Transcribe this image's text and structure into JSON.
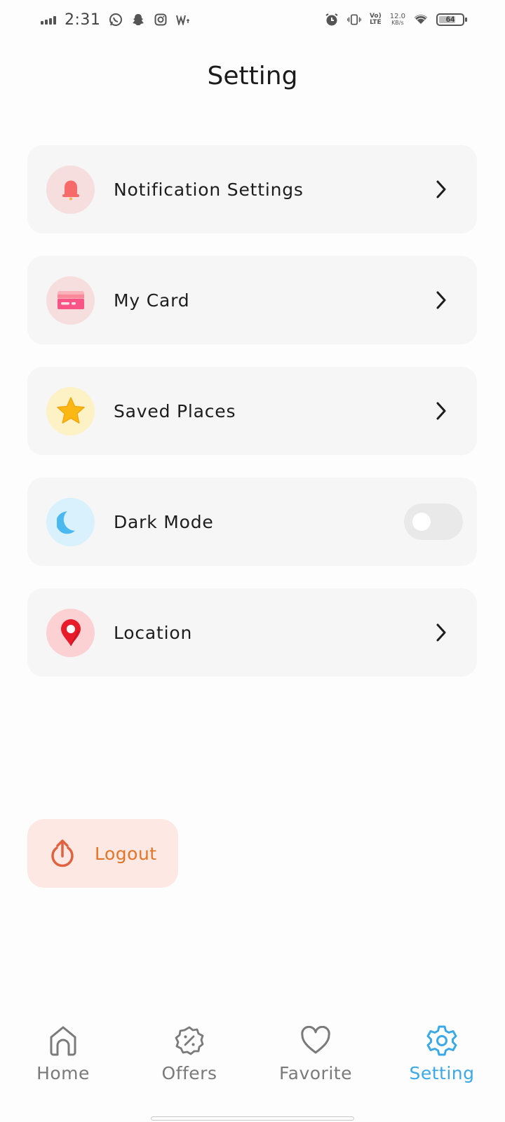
{
  "status_bar": {
    "time": "2:31",
    "net_speed_value": "12.0",
    "net_speed_unit": "KB/s",
    "volte_top": "Vo)",
    "volte_bottom": "LTE",
    "battery_level": "64",
    "notification_icons": [
      "whatsapp-icon",
      "snapchat-icon",
      "instagram-icon",
      "w-app-icon"
    ]
  },
  "header": {
    "title": "Setting"
  },
  "settings": {
    "items": [
      {
        "label": "Notification Settings",
        "icon": "bell-icon",
        "icon_bg": "#f6dede",
        "control": "chevron"
      },
      {
        "label": "My Card",
        "icon": "card-icon",
        "icon_bg": "#f6dede",
        "control": "chevron"
      },
      {
        "label": "Saved Places",
        "icon": "star-icon",
        "icon_bg": "#fdf1c6",
        "control": "chevron"
      },
      {
        "label": "Dark Mode",
        "icon": "moon-icon",
        "icon_bg": "#d8f1fc",
        "control": "toggle",
        "toggle_on": false
      },
      {
        "label": "Location",
        "icon": "location-pin-icon",
        "icon_bg": "#fbd1d3",
        "control": "chevron"
      }
    ]
  },
  "logout": {
    "label": "Logout",
    "color": "#e27527",
    "bg": "#fde8e3"
  },
  "bottom_nav": {
    "active": "Setting",
    "active_color": "#3ba9e6",
    "items": [
      {
        "label": "Home",
        "icon": "home-icon"
      },
      {
        "label": "Offers",
        "icon": "offers-badge-icon"
      },
      {
        "label": "Favorite",
        "icon": "heart-icon"
      },
      {
        "label": "Setting",
        "icon": "gear-icon"
      }
    ]
  }
}
